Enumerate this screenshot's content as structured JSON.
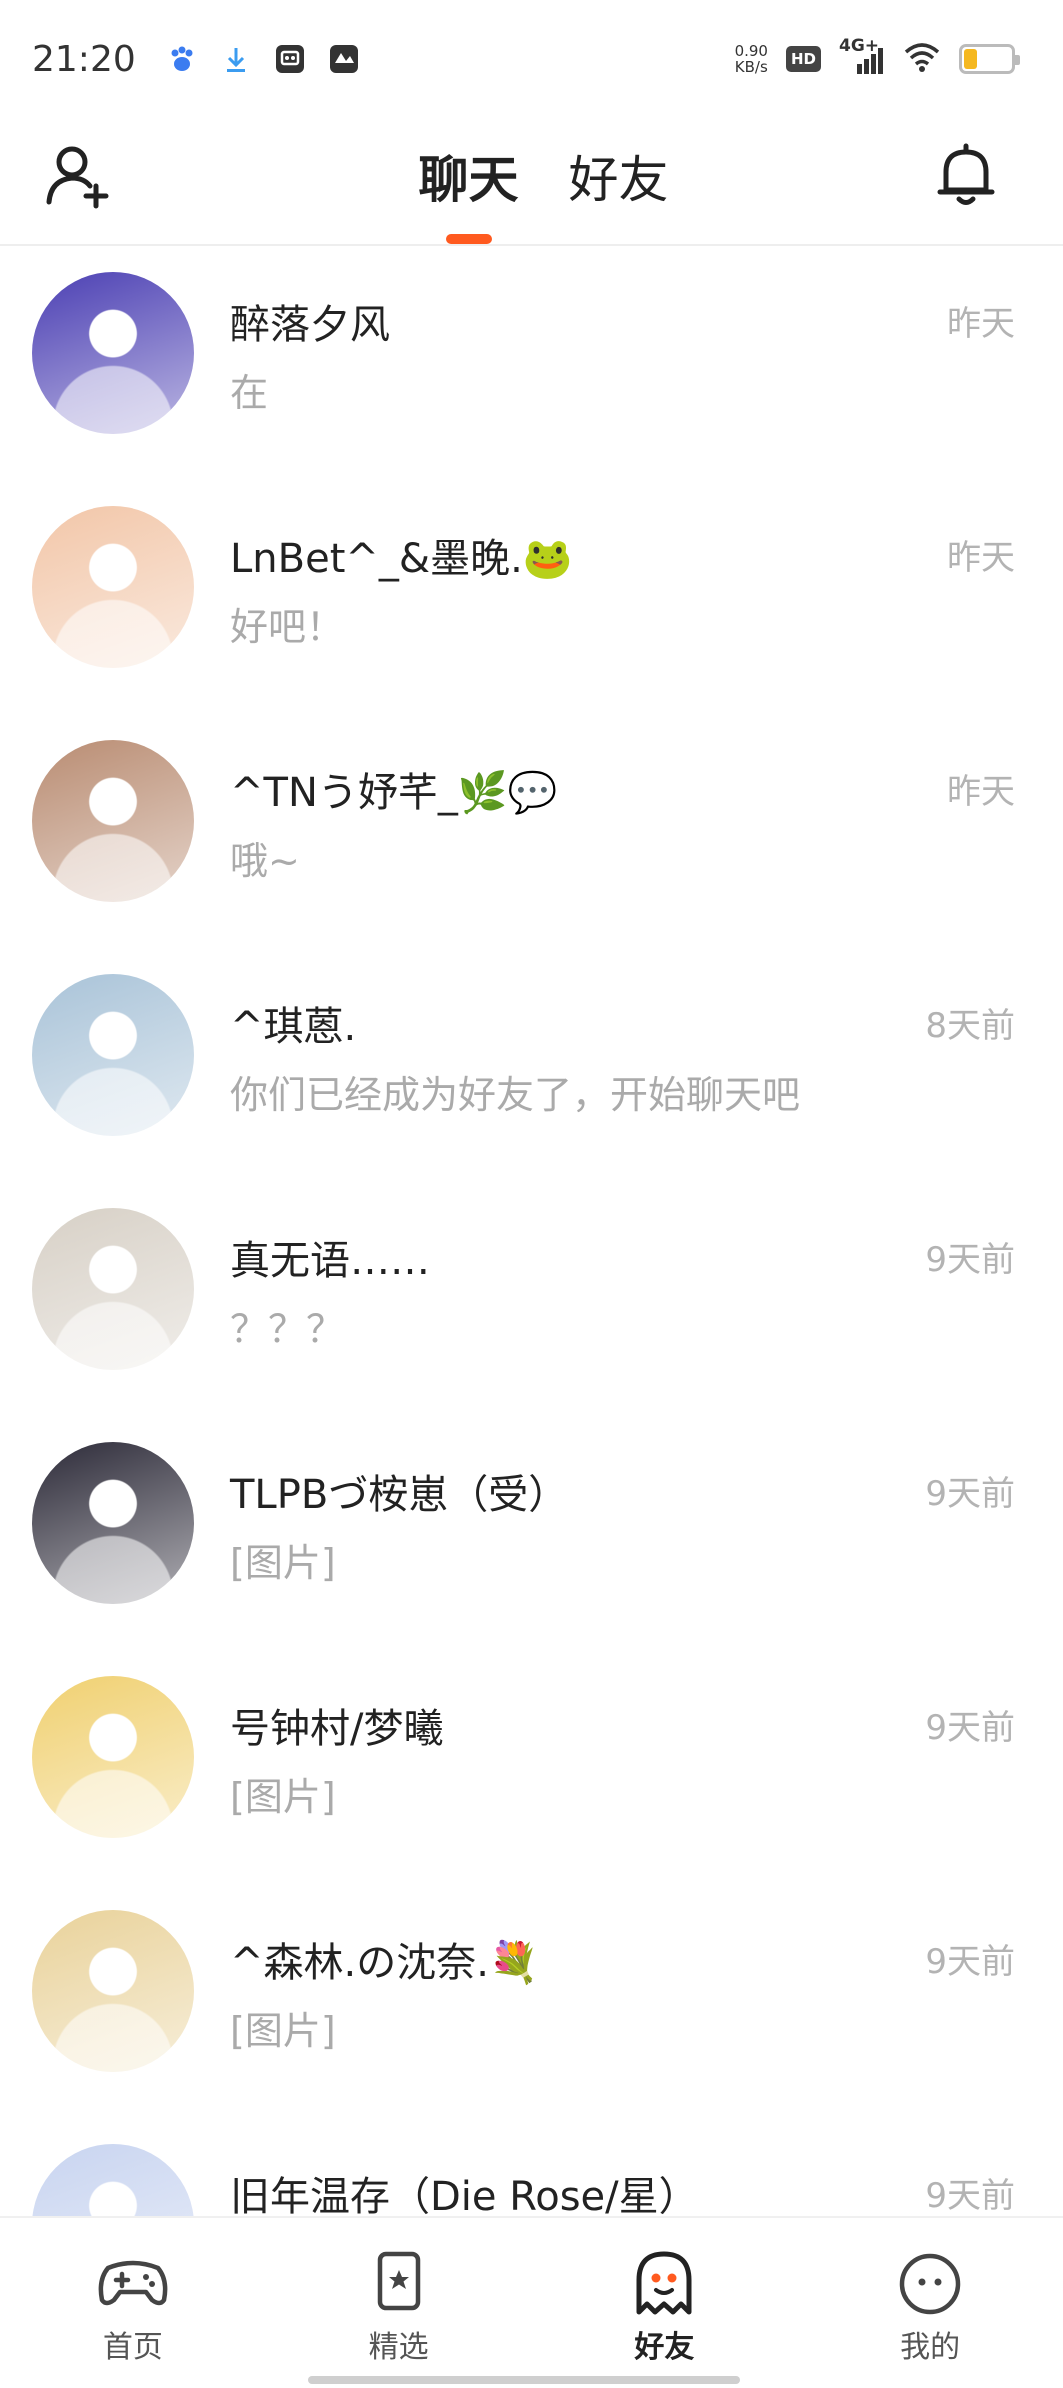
{
  "status_bar": {
    "time": "21:20",
    "net_speed_value": "0.90",
    "net_speed_unit": "KB/s",
    "hd_label": "HD",
    "network_label": "4G+",
    "battery_level": 0.25,
    "icons": [
      "baidu-paw-icon",
      "download-icon",
      "app-icon",
      "app-icon-2",
      "signal-icon",
      "wifi-icon",
      "battery-icon"
    ]
  },
  "header": {
    "tabs": [
      {
        "label": "聊天",
        "active": true
      },
      {
        "label": "好友",
        "active": false
      }
    ],
    "accent_color": "#ff5a1f"
  },
  "chats": [
    {
      "name": "醉落夕风",
      "preview": "在",
      "time": "昨天",
      "avatar_color": "#4b3fb3"
    },
    {
      "name": "LnBet^_&墨晚.🐸",
      "preview": "好吧！",
      "time": "昨天",
      "avatar_color": "#f2c6a8"
    },
    {
      "name": "^TNう妤芊_🌿💬",
      "preview": "哦~",
      "time": "昨天",
      "avatar_color": "#b98c72"
    },
    {
      "name": "^琪蒽.",
      "preview": "你们已经成为好友了，开始聊天吧",
      "time": "8天前",
      "avatar_color": "#a9c3d8"
    },
    {
      "name": "真无语……",
      "preview": "？？？",
      "time": "9天前",
      "avatar_color": "#d7d0c6"
    },
    {
      "name": "TLPBづ桉崽（受）",
      "preview": "[图片]",
      "time": "9天前",
      "avatar_color": "#2c2a38"
    },
    {
      "name": "号钟村/梦曦",
      "preview": "[图片]",
      "time": "9天前",
      "avatar_color": "#f0d070"
    },
    {
      "name": "^森林.の沈奈.💐",
      "preview": "[图片]",
      "time": "9天前",
      "avatar_color": "#e9d29a"
    },
    {
      "name": "旧年温存（Die Rose/星）",
      "preview": "",
      "time": "9天前",
      "avatar_color": "#c8d4f0"
    }
  ],
  "bottom_nav": [
    {
      "label": "首页",
      "icon": "gamepad-icon",
      "active": false
    },
    {
      "label": "精选",
      "icon": "bookmark-star-icon",
      "active": false
    },
    {
      "label": "好友",
      "icon": "ghost-icon",
      "active": true
    },
    {
      "label": "我的",
      "icon": "face-icon",
      "active": false
    }
  ]
}
